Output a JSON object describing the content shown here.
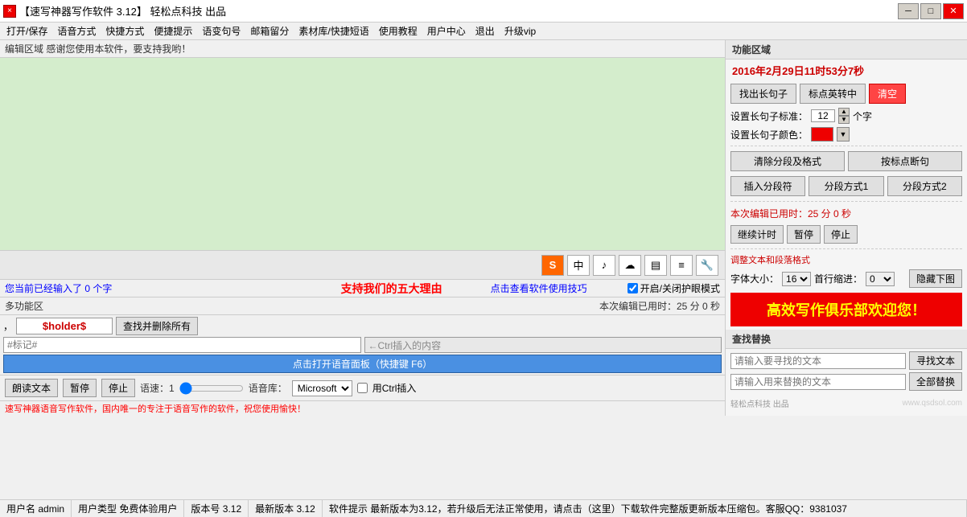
{
  "titlebar": {
    "title": "【速写神器写作软件 3.12】  轻松点科技  出品",
    "close": "×",
    "minimize": "─",
    "maximize": "□",
    "close_btn": "✕"
  },
  "menu": {
    "items": [
      "打开/保存",
      "语音方式",
      "快捷方式",
      "便捷提示",
      "语变句号",
      "邮箱留分",
      "素材库/快捷短语",
      "使用教程",
      "用户中心",
      "退出",
      "升级vip"
    ]
  },
  "editor": {
    "label": "编辑区域  感谢您使用本软件，要支持我哟！",
    "placeholder": "",
    "content": "",
    "toolbar_icons": [
      "S",
      "中",
      "♪",
      "☁",
      "▤",
      "≡",
      "🔧"
    ]
  },
  "editor_status": {
    "word_count": "您当前已经输入了 0 个字",
    "five_reasons": "支持我们的五大理由",
    "tips": "点击查看软件使用技巧",
    "eye_mode_label": "开启/关闭护眼模式",
    "checkbox": true
  },
  "multifunction": {
    "label": "多功能区",
    "time_used": "本次编辑已用时：25 分 0 秒"
  },
  "controls": {
    "read_btn": "朗读文本",
    "pause_btn": "暂停",
    "stop_btn": "停止",
    "speed_label": "语速：1",
    "lib_label": "语音库：",
    "lib_value": "Microsoft",
    "ctrl_label": "用Ctrl插入",
    "warning": "速写神器语音写作软件，国内唯一的专注于语音写作的软件，祝您使用愉快！"
  },
  "center_bottom": {
    "placeholder_text": "$holder$",
    "ctrl_insert_hint": "←Ctrl插入的内容",
    "find_and_delete_btn": "查找并删除所有",
    "open_panel_btn": "点击打开语音面板（快捷键 F6）",
    "tag_input_placeholder": "#标记#"
  },
  "right_panel": {
    "section_title": "功能区域",
    "datetime": "2016年2月29日11时53分7秒",
    "extract_long_btn": "找出长句子",
    "mark_english_btn": "标点英转中",
    "clear_btn": "清空",
    "long_sentence_label": "设置长句子标准：",
    "long_sentence_value": "12",
    "long_sentence_unit": "个字",
    "color_label": "设置长句子颜色：",
    "clear_format_btn": "清除分段及格式",
    "by_punctuation_btn": "按标点断句",
    "insert_segment_btn": "插入分段符",
    "segment_mode1_btn": "分段方式1",
    "segment_mode2_btn": "分段方式2",
    "timer_label": "本次编辑已用时：25 分 0 秒",
    "continue_btn": "继续计时",
    "pause_btn": "暂停",
    "stop_btn": "停止",
    "adjust_title": "调整文本和段落格式",
    "font_size_label": "字体大小：",
    "font_size_value": "16",
    "first_indent_label": "首行缩进：",
    "first_indent_value": "0",
    "hide_image_btn": "隐藏下图",
    "promo_text": "高效写作俱乐部欢迎您！",
    "find_replace_title": "查找替换",
    "find_placeholder": "请输入要寻找的文本",
    "find_btn": "寻找文本",
    "replace_placeholder": "请输入用来替换的文本",
    "replace_all_btn": "全部替换",
    "watermark1": "轻松点科技  出品",
    "watermark2": "www.qsdsol.com"
  },
  "status_footer": {
    "username_label": "用户名",
    "username": "admin",
    "user_type_label": "用户类型",
    "user_type": "免费体验用户",
    "version_label": "版本号",
    "version": "3.12",
    "latest_label": "最新版本",
    "latest": "3.12",
    "software_tip_label": "软件提示",
    "software_tip": "最新版本为3.12，若升级后无法正常使用，请点击（这里）下载软件完整版更新版本压缩包。客服QQ：9381037"
  }
}
